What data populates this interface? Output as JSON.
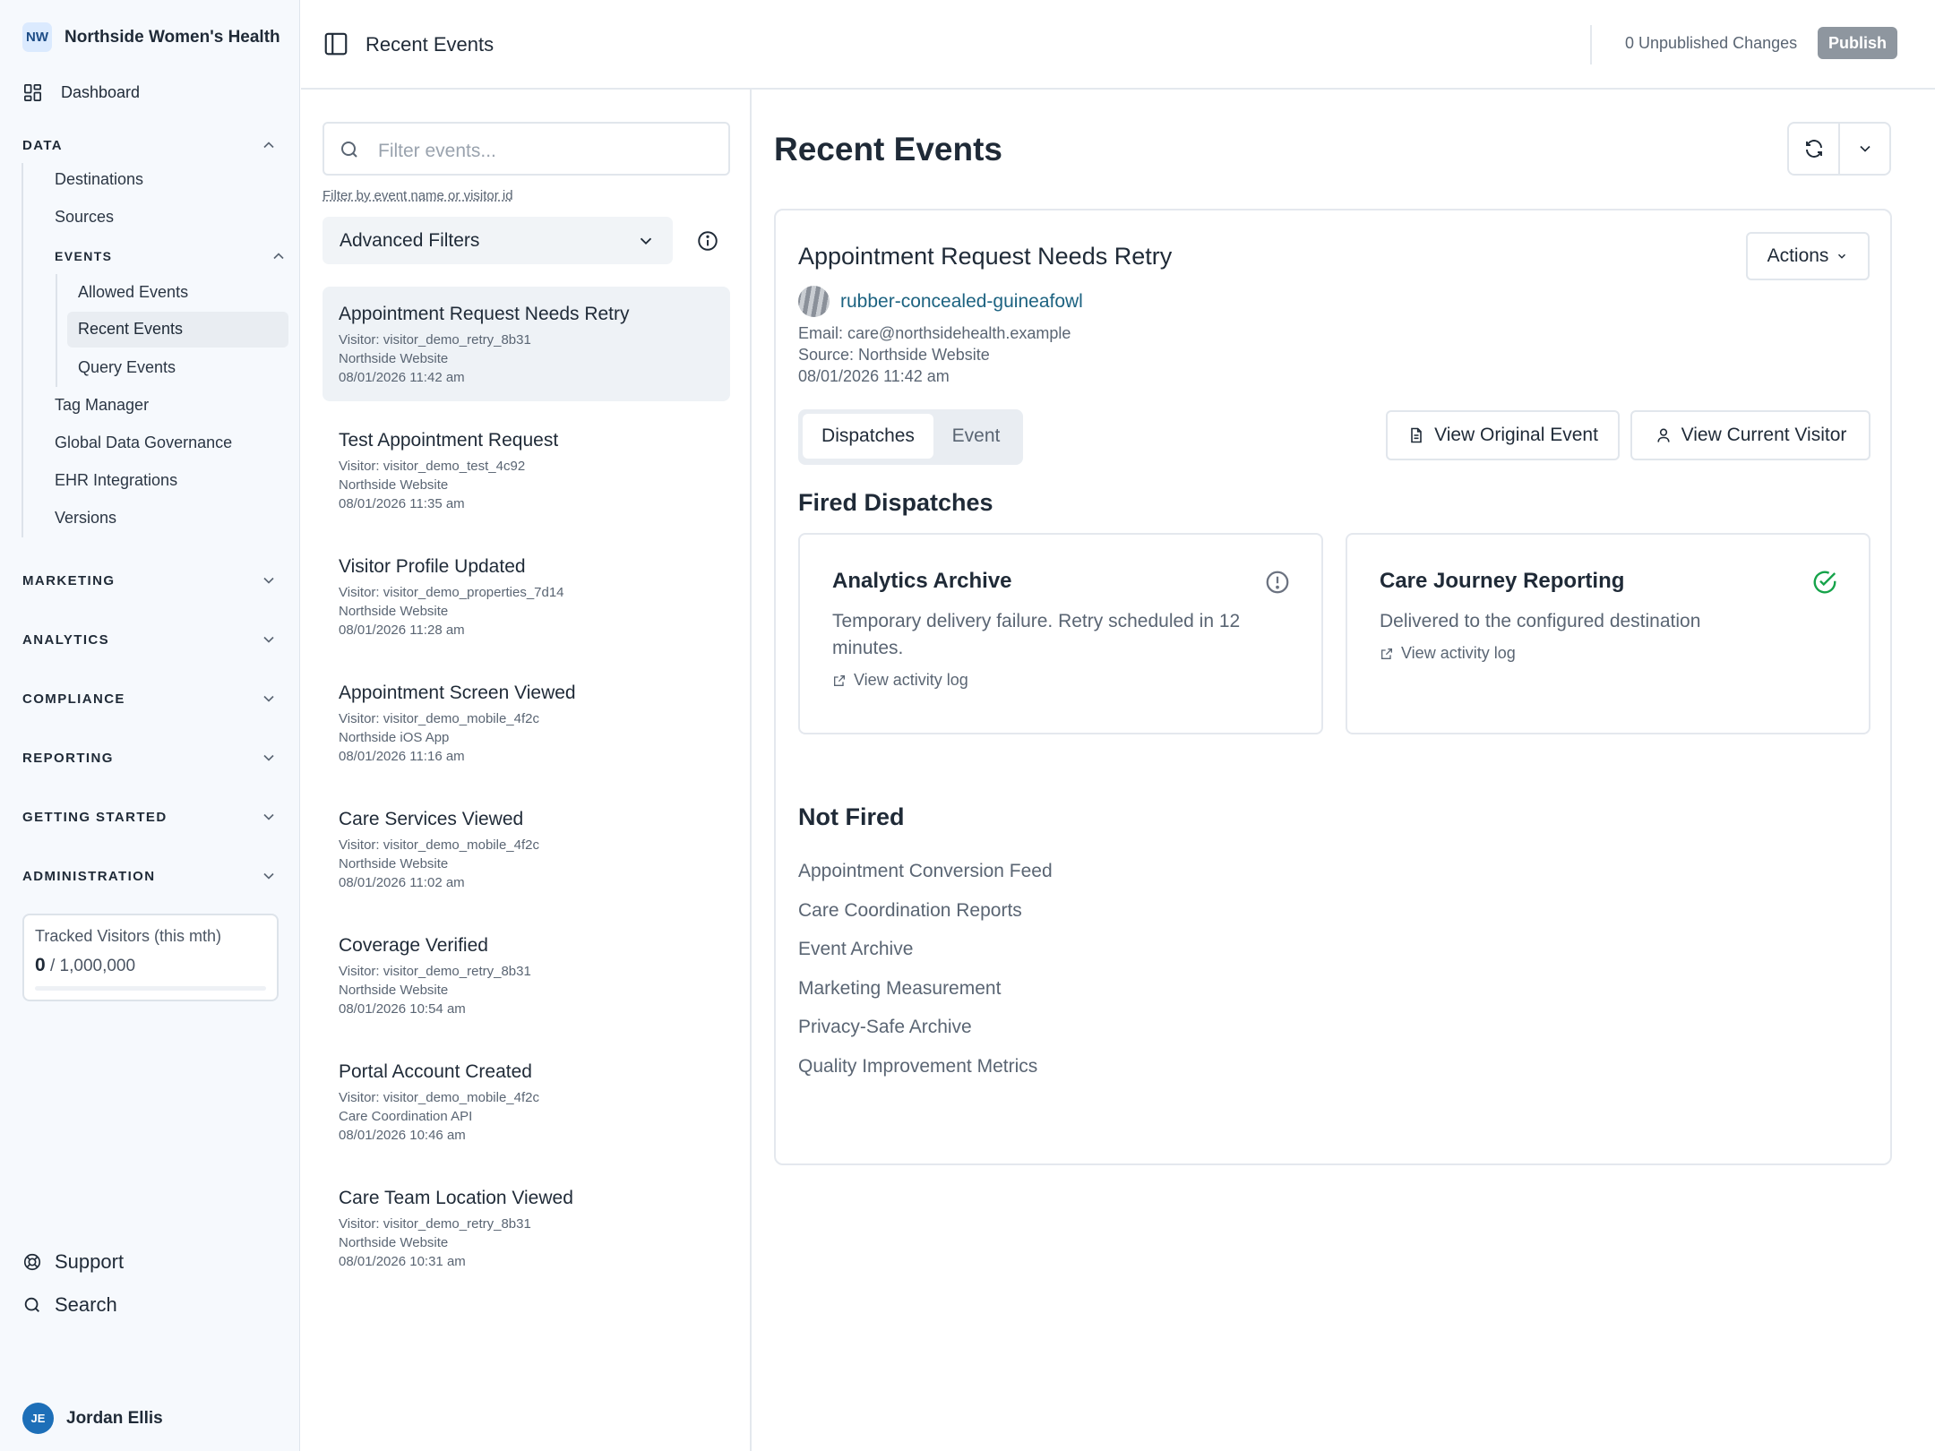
{
  "org": {
    "initials": "NW",
    "name": "Northside Women's Health"
  },
  "sidebar": {
    "dashboard": "Dashboard",
    "data_section": "DATA",
    "data_items": [
      "Destinations",
      "Sources"
    ],
    "events_section": "EVENTS",
    "events_items": [
      "Allowed Events",
      "Recent Events",
      "Query Events"
    ],
    "more_items": [
      "Tag Manager",
      "Global Data Governance",
      "EHR Integrations",
      "Versions"
    ],
    "sections": [
      "MARKETING",
      "ANALYTICS",
      "COMPLIANCE",
      "REPORTING",
      "GETTING STARTED",
      "ADMINISTRATION"
    ],
    "visitors_label": "Tracked Visitors (this mth)",
    "visitors_used": "0",
    "visitors_limit": "/ 1,000,000",
    "visitors_fraction": 0,
    "support": "Support",
    "search": "Search",
    "user_initials": "JE",
    "user_name": "Jordan Ellis"
  },
  "header": {
    "title": "Recent Events",
    "unpublished": "0 Unpublished Changes",
    "publish": "Publish"
  },
  "list": {
    "search_placeholder": "Filter events...",
    "hint": "Filter by event name or visitor id",
    "advanced_filters": "Advanced Filters",
    "events": [
      {
        "title": "Appointment Request Needs Retry",
        "visitor": "Visitor: visitor_demo_retry_8b31",
        "source": "Northside Website",
        "time": "08/01/2026 11:42 am"
      },
      {
        "title": "Test Appointment Request",
        "visitor": "Visitor: visitor_demo_test_4c92",
        "source": "Northside Website",
        "time": "08/01/2026 11:35 am"
      },
      {
        "title": "Visitor Profile Updated",
        "visitor": "Visitor: visitor_demo_properties_7d14",
        "source": "Northside Website",
        "time": "08/01/2026 11:28 am"
      },
      {
        "title": "Appointment Screen Viewed",
        "visitor": "Visitor: visitor_demo_mobile_4f2c",
        "source": "Northside iOS App",
        "time": "08/01/2026 11:16 am"
      },
      {
        "title": "Care Services Viewed",
        "visitor": "Visitor: visitor_demo_mobile_4f2c",
        "source": "Northside Website",
        "time": "08/01/2026 11:02 am"
      },
      {
        "title": "Coverage Verified",
        "visitor": "Visitor: visitor_demo_retry_8b31",
        "source": "Northside Website",
        "time": "08/01/2026 10:54 am"
      },
      {
        "title": "Portal Account Created",
        "visitor": "Visitor: visitor_demo_mobile_4f2c",
        "source": "Care Coordination API",
        "time": "08/01/2026 10:46 am"
      },
      {
        "title": "Care Team Location Viewed",
        "visitor": "Visitor: visitor_demo_retry_8b31",
        "source": "Northside Website",
        "time": "08/01/2026 10:31 am"
      }
    ]
  },
  "detail": {
    "page_title": "Recent Events",
    "event_title": "Appointment Request Needs Retry",
    "actions": "Actions",
    "visitor_name": "rubber-concealed-guineafowl",
    "email": "Email: care@northsidehealth.example",
    "source": "Source: Northside Website",
    "time": "08/01/2026 11:42 am",
    "tab_dispatches": "Dispatches",
    "tab_event": "Event",
    "view_original": "View Original Event",
    "view_visitor": "View Current Visitor",
    "fired_heading": "Fired Dispatches",
    "fired": [
      {
        "name": "Analytics Archive",
        "desc": "Temporary delivery failure. Retry scheduled in 12 minutes.",
        "link": "View activity log",
        "status_icon": "alert-circle-icon",
        "status_color": "#6b7280"
      },
      {
        "name": "Care Journey Reporting",
        "desc": "Delivered to the configured destination",
        "link": "View activity log",
        "status_icon": "check-circle-icon",
        "status_color": "#16a34a"
      }
    ],
    "not_fired_heading": "Not Fired",
    "not_fired": [
      "Appointment Conversion Feed",
      "Care Coordination Reports",
      "Event Archive",
      "Marketing Measurement",
      "Privacy-Safe Archive",
      "Quality Improvement Metrics"
    ]
  }
}
